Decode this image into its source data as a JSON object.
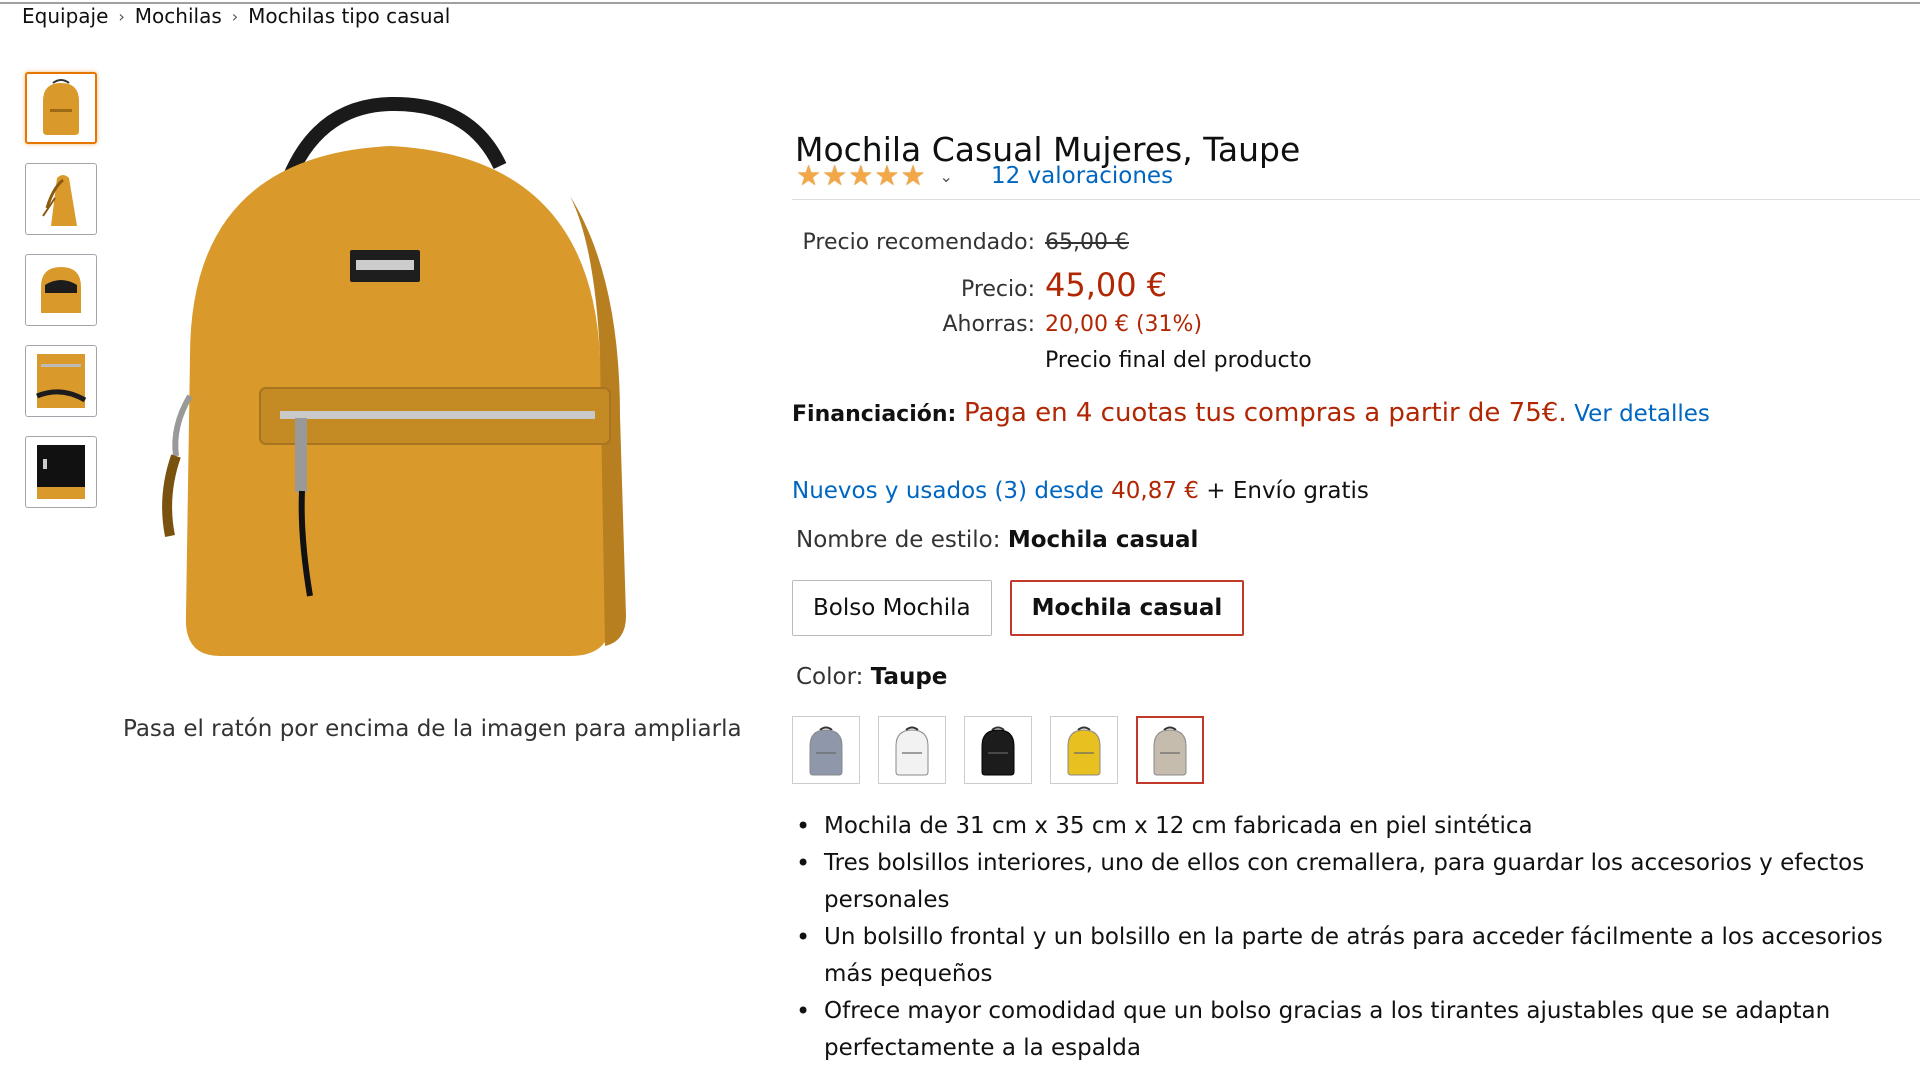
{
  "breadcrumb": [
    "Equipaje",
    "Mochilas",
    "Mochilas tipo casual"
  ],
  "thumbnails": [
    "thumb-front",
    "thumb-side",
    "thumb-open",
    "thumb-detail",
    "thumb-inside"
  ],
  "image_hint": "Pasa el ratón por encima de la imagen para ampliarla",
  "product": {
    "title": "Mochila Casual Mujeres, Taupe",
    "rating_stars": 5,
    "ratings_text": "12 valoraciones"
  },
  "price": {
    "recommended_label": "Precio recomendado:",
    "recommended_value": "65,00 €",
    "price_label": "Precio:",
    "price_value": "45,00 €",
    "savings_label": "Ahorras:",
    "savings_value": "20,00 € (31%)",
    "final_note": "Precio final del producto"
  },
  "financing": {
    "label": "Financiación:",
    "text": "Paga en 4 cuotas tus compras a partir de 75€.",
    "link": "Ver detalles"
  },
  "offers": {
    "link": "Nuevos y usados (3) desde",
    "price": "40,87 €",
    "shipping": "+ Envío gratis"
  },
  "style": {
    "label": "Nombre de estilo:",
    "selected": "Mochila casual",
    "options": [
      "Bolso Mochila",
      "Mochila casual"
    ]
  },
  "color": {
    "label": "Color:",
    "selected": "Taupe",
    "swatches": [
      "#8e98aa",
      "#f2f2f2",
      "#1c1c1c",
      "#e8c020",
      "#c6bcae"
    ]
  },
  "features": [
    "Mochila de 31 cm x 35 cm x 12 cm fabricada en piel sintética",
    "Tres bolsillos interiores, uno de ellos con cremallera, para guardar los accesorios y efectos personales",
    "Un bolsillo frontal y un bolsillo en la parte de atrás para acceder fácilmente a los accesorios más pequeños",
    "Ofrece mayor comodidad que un bolso gracias a los tirantes ajustables que se adaptan perfectamente a la espalda"
  ],
  "colors": {
    "accent_price": "#b12704",
    "link": "#0066c0",
    "bag_main": "#d99a2b"
  }
}
